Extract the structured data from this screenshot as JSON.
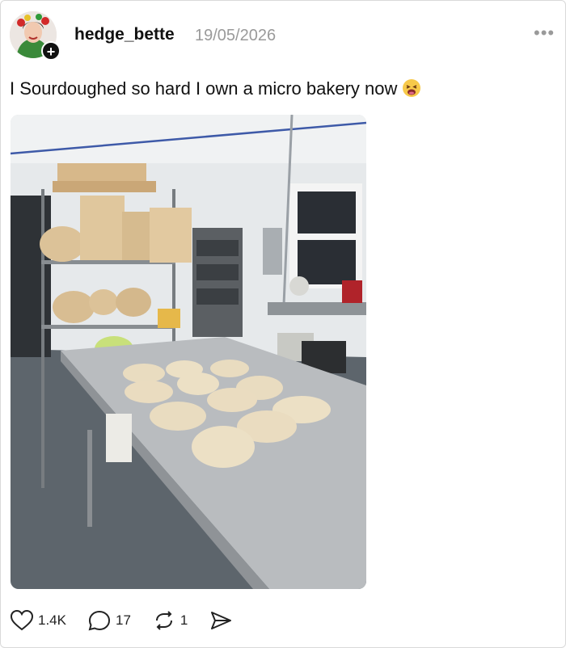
{
  "post": {
    "username": "hedge_bette",
    "date": "19/05/2026",
    "text": "I Sourdoughed so hard I own a micro bakery now",
    "emoji": "tired-face-emoji",
    "more_icon": "•••"
  },
  "actions": {
    "likes": "1.4K",
    "comments": "17",
    "reposts": "1"
  },
  "icons": {
    "like": "heart-icon",
    "comment": "speech-bubble-icon",
    "repost": "repost-icon",
    "share": "send-icon",
    "follow": "plus-icon"
  },
  "colors": {
    "text": "#101010",
    "muted": "#9a9a9a",
    "border": "#d9d9d9"
  }
}
